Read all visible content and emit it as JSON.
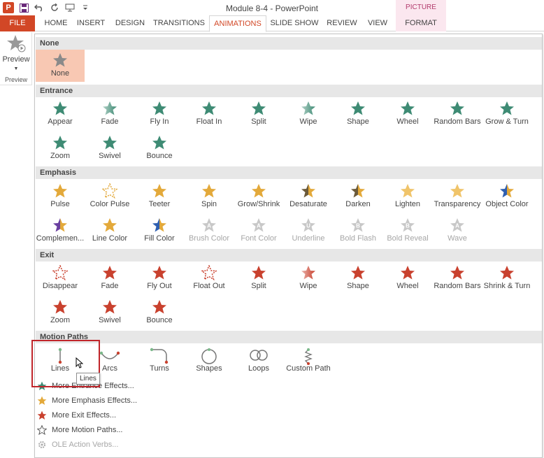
{
  "window": {
    "title": "Module 8-4 - PowerPoint",
    "context_tools_label": "PICTURE TOOLS"
  },
  "tabs": [
    "FILE",
    "HOME",
    "INSERT",
    "DESIGN",
    "TRANSITIONS",
    "ANIMATIONS",
    "SLIDE SHOW",
    "REVIEW",
    "VIEW",
    "FORMAT"
  ],
  "active_tab": "ANIMATIONS",
  "preview_group": {
    "button_label": "Preview",
    "group_label": "Preview"
  },
  "sections": {
    "none": {
      "header": "None",
      "items": [
        {
          "label": "None",
          "icon": "star-gray",
          "selected": true
        }
      ]
    },
    "entrance": {
      "header": "Entrance",
      "items": [
        {
          "label": "Appear",
          "icon": "star-green"
        },
        {
          "label": "Fade",
          "icon": "star-green-fade"
        },
        {
          "label": "Fly In",
          "icon": "star-green"
        },
        {
          "label": "Float In",
          "icon": "star-green"
        },
        {
          "label": "Split",
          "icon": "star-green"
        },
        {
          "label": "Wipe",
          "icon": "star-green-fade"
        },
        {
          "label": "Shape",
          "icon": "star-green"
        },
        {
          "label": "Wheel",
          "icon": "star-green"
        },
        {
          "label": "Random Bars",
          "icon": "star-green"
        },
        {
          "label": "Grow & Turn",
          "icon": "star-green"
        },
        {
          "label": "Zoom",
          "icon": "star-green"
        },
        {
          "label": "Swivel",
          "icon": "star-green"
        },
        {
          "label": "Bounce",
          "icon": "star-green"
        }
      ]
    },
    "emphasis": {
      "header": "Emphasis",
      "items": [
        {
          "label": "Pulse",
          "icon": "star-gold",
          "disabled": false
        },
        {
          "label": "Color Pulse",
          "icon": "star-gold-outline",
          "disabled": false
        },
        {
          "label": "Teeter",
          "icon": "star-gold",
          "disabled": false
        },
        {
          "label": "Spin",
          "icon": "star-gold",
          "disabled": false
        },
        {
          "label": "Grow/Shrink",
          "icon": "star-gold",
          "disabled": false
        },
        {
          "label": "Desaturate",
          "icon": "star-gold-dark",
          "disabled": false
        },
        {
          "label": "Darken",
          "icon": "star-gold-dark",
          "disabled": false
        },
        {
          "label": "Lighten",
          "icon": "star-gold-light",
          "disabled": false
        },
        {
          "label": "Transparency",
          "icon": "star-gold-light",
          "disabled": false
        },
        {
          "label": "Object Color",
          "icon": "star-gold-blue",
          "disabled": false
        },
        {
          "label": "Complemen...",
          "icon": "star-gold-purple",
          "disabled": false
        },
        {
          "label": "Line Color",
          "icon": "star-gold",
          "disabled": false
        },
        {
          "label": "Fill Color",
          "icon": "star-gold-blue",
          "disabled": false
        },
        {
          "label": "Brush Color",
          "icon": "star-gray-light",
          "disabled": true
        },
        {
          "label": "Font Color",
          "icon": "star-gray-light",
          "disabled": true
        },
        {
          "label": "Underline",
          "icon": "star-gray-light",
          "disabled": true
        },
        {
          "label": "Bold Flash",
          "icon": "star-gray-light",
          "disabled": true
        },
        {
          "label": "Bold Reveal",
          "icon": "star-gray-light",
          "disabled": true
        },
        {
          "label": "Wave",
          "icon": "star-gray-light",
          "disabled": true
        }
      ]
    },
    "exit": {
      "header": "Exit",
      "items": [
        {
          "label": "Disappear",
          "icon": "star-red-outline"
        },
        {
          "label": "Fade",
          "icon": "star-red"
        },
        {
          "label": "Fly Out",
          "icon": "star-red"
        },
        {
          "label": "Float Out",
          "icon": "star-red-outline"
        },
        {
          "label": "Split",
          "icon": "star-red"
        },
        {
          "label": "Wipe",
          "icon": "star-red-fade"
        },
        {
          "label": "Shape",
          "icon": "star-red"
        },
        {
          "label": "Wheel",
          "icon": "star-red"
        },
        {
          "label": "Random Bars",
          "icon": "star-red"
        },
        {
          "label": "Shrink & Turn",
          "icon": "star-red"
        },
        {
          "label": "Zoom",
          "icon": "star-red"
        },
        {
          "label": "Swivel",
          "icon": "star-red"
        },
        {
          "label": "Bounce",
          "icon": "star-red"
        }
      ]
    },
    "motion": {
      "header": "Motion Paths",
      "items": [
        {
          "label": "Lines",
          "icon": "path-line"
        },
        {
          "label": "Arcs",
          "icon": "path-arc"
        },
        {
          "label": "Turns",
          "icon": "path-turn"
        },
        {
          "label": "Shapes",
          "icon": "path-circle"
        },
        {
          "label": "Loops",
          "icon": "path-loop"
        },
        {
          "label": "Custom Path",
          "icon": "path-custom"
        }
      ]
    }
  },
  "tooltip": "Lines",
  "more_links": [
    {
      "label": "More Entrance Effects...",
      "icon": "star-green",
      "disabled": false
    },
    {
      "label": "More Emphasis Effects...",
      "icon": "star-gold",
      "disabled": false
    },
    {
      "label": "More Exit Effects...",
      "icon": "star-red",
      "disabled": false
    },
    {
      "label": "More Motion Paths...",
      "icon": "star-outline",
      "disabled": false
    },
    {
      "label": "OLE Action Verbs...",
      "icon": "gear-icon",
      "disabled": true
    }
  ],
  "colors": {
    "accent": "#d24726",
    "entrance_green": "#3e8b74",
    "emphasis_gold": "#e3a93a",
    "exit_red": "#c9412e",
    "selection_border": "#c0252a",
    "header_bg": "#e7e7e7",
    "selected_bg": "#f8c8b3"
  }
}
